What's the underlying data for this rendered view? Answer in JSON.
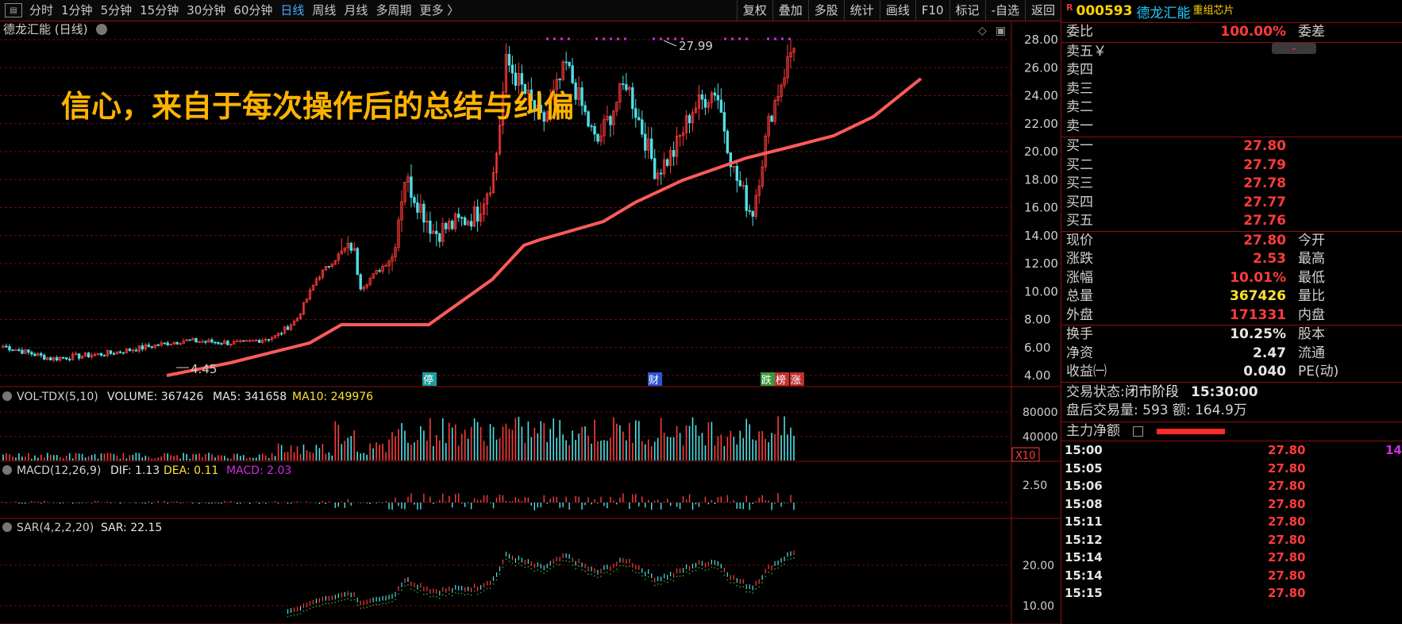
{
  "toolbar": {
    "periods": [
      "分时",
      "1分钟",
      "5分钟",
      "15分钟",
      "30分钟",
      "60分钟",
      "日线",
      "周线",
      "月线",
      "多周期",
      "更多 〉"
    ],
    "active": "日线",
    "buttons": [
      "复权",
      "叠加",
      "多股",
      "统计",
      "画线",
      "F10",
      "标记",
      "-自选",
      "返回"
    ]
  },
  "chart": {
    "title": "德龙汇能 (日线)",
    "headline": "信心，来自于每次操作后的总结与纠偏",
    "high_label": "27.99",
    "low_label": "4.45",
    "price_axis": [
      "28.00",
      "26.00",
      "24.00",
      "22.00",
      "20.00",
      "18.00",
      "16.00",
      "14.00",
      "12.00",
      "10.00",
      "8.00",
      "6.00",
      "4.00"
    ],
    "markers": [
      "停",
      "财",
      "跌",
      "榜",
      "涨"
    ],
    "vol_header": {
      "name": "VOL-TDX(5,10)",
      "volume": "VOLUME: 367426",
      "ma5": "MA5: 341658",
      "ma10": "MA10: 249976"
    },
    "vol_axis": [
      "80000",
      "40000"
    ],
    "vol_unit": "X10",
    "macd_header": {
      "name": "MACD(12,26,9)",
      "dif": "DIF: 1.13",
      "dea": "DEA: 0.11",
      "macd": "MACD: 2.03"
    },
    "macd_axis": [
      "2.50"
    ],
    "sar_header": {
      "name": "SAR(4,2,2,20)",
      "sar": "SAR: 22.15"
    },
    "sar_axis": [
      "20.00",
      "10.00"
    ],
    "colors": {
      "up": "#ff3b3b",
      "down": "#4fe0e6",
      "ma": "#ff5a5a",
      "yellow": "#ffe033",
      "magenta": "#d02be0",
      "grid": "#6a0f0f"
    }
  },
  "panel": {
    "r_mark": "R",
    "code": "000593",
    "name": "德龙汇能",
    "tag": "重组芯片",
    "weibi": {
      "label": "委比",
      "value": "100.00%",
      "label2": "委差"
    },
    "sells": [
      "卖五￥",
      "卖四",
      "卖三",
      "卖二",
      "卖一"
    ],
    "buys": [
      {
        "label": "买一",
        "price": "27.80"
      },
      {
        "label": "买二",
        "price": "27.79"
      },
      {
        "label": "买三",
        "price": "27.78"
      },
      {
        "label": "买四",
        "price": "27.77"
      },
      {
        "label": "买五",
        "price": "27.76"
      }
    ],
    "quote": [
      {
        "label": "现价",
        "value": "27.80",
        "label2": "今开",
        "color": "red"
      },
      {
        "label": "涨跌",
        "value": "2.53",
        "label2": "最高",
        "color": "red"
      },
      {
        "label": "涨幅",
        "value": "10.01%",
        "label2": "最低",
        "color": "red"
      },
      {
        "label": "总量",
        "value": "367426",
        "label2": "量比",
        "color": "yellow"
      },
      {
        "label": "外盘",
        "value": "171331",
        "label2": "内盘",
        "color": "red"
      }
    ],
    "fundamentals": [
      {
        "label": "换手",
        "value": "10.25%",
        "label2": "股本"
      },
      {
        "label": "净资",
        "value": "2.47",
        "label2": "流通"
      },
      {
        "label": "收益㈠",
        "value": "0.040",
        "label2": "PE(动)"
      }
    ],
    "trade_status": {
      "label": "交易状态:",
      "status": "闭市阶段",
      "time": "15:30:00"
    },
    "after_hours": "盘后交易量: 593  额: 164.9万",
    "main_flow": "主力净额",
    "ticks": [
      {
        "time": "15:00",
        "price": "27.80",
        "vol": "14"
      },
      {
        "time": "15:05",
        "price": "27.80",
        "vol": ""
      },
      {
        "time": "15:06",
        "price": "27.80",
        "vol": ""
      },
      {
        "time": "15:08",
        "price": "27.80",
        "vol": ""
      },
      {
        "time": "15:11",
        "price": "27.80",
        "vol": ""
      },
      {
        "time": "15:12",
        "price": "27.80",
        "vol": ""
      },
      {
        "time": "15:14",
        "price": "27.80",
        "vol": ""
      },
      {
        "time": "15:14",
        "price": "27.80",
        "vol": ""
      },
      {
        "time": "15:15",
        "price": "27.80",
        "vol": ""
      }
    ]
  }
}
